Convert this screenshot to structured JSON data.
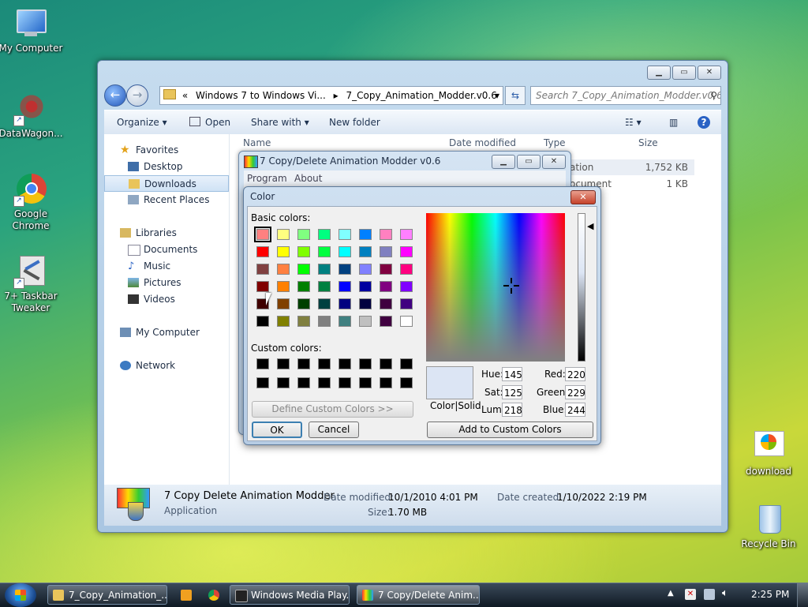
{
  "desktop": {
    "icons": [
      {
        "label": "My Computer"
      },
      {
        "label": "DataWagon..."
      },
      {
        "label": "Google Chrome"
      },
      {
        "label": "7+ Taskbar Tweaker"
      },
      {
        "label": "download"
      },
      {
        "label": "Recycle Bin"
      }
    ]
  },
  "explorer": {
    "address_crumbs": [
      "Windows 7 to Windows Vi...",
      "7_Copy_Animation_Modder.v0.6"
    ],
    "search_placeholder": "Search 7_Copy_Animation_Modder.v0.6",
    "toolbar": {
      "organize": "Organize",
      "open": "Open",
      "share_with": "Share with",
      "new_folder": "New folder"
    },
    "nav": {
      "favorites": "Favorites",
      "desktop": "Desktop",
      "downloads": "Downloads",
      "recent": "Recent Places",
      "libraries": "Libraries",
      "documents": "Documents",
      "music": "Music",
      "pictures": "Pictures",
      "videos": "Videos",
      "my_computer": "My Computer",
      "network": "Network"
    },
    "columns": {
      "name": "Name",
      "date": "Date modified",
      "type": "Type",
      "size": "Size"
    },
    "rows": [
      {
        "type": "ation",
        "size": "1,752 KB"
      },
      {
        "type": "ocument",
        "size": "1 KB"
      }
    ],
    "details": {
      "name": "7 Copy Delete Animation Modder",
      "kind": "Application",
      "date_modified_label": "Date modified:",
      "date_modified": "10/1/2010 4:01 PM",
      "size_label": "Size:",
      "size": "1.70 MB",
      "date_created_label": "Date created:",
      "date_created": "1/10/2022 2:19 PM"
    }
  },
  "modder": {
    "title": "7 Copy/Delete Animation Modder v0.6",
    "menu": {
      "program": "Program",
      "about": "About"
    }
  },
  "color_dialog": {
    "title": "Color",
    "basic_label": "Basic colors:",
    "custom_label": "Custom colors:",
    "define_button": "Define Custom Colors >>",
    "ok": "OK",
    "cancel": "Cancel",
    "add_button": "Add to Custom Colors",
    "color_solid": "Color|Solid",
    "fields": {
      "hue_label": "Hue:",
      "hue": "145",
      "sat_label": "Sat:",
      "sat": "125",
      "lum_label": "Lum:",
      "lum": "218",
      "red_label": "Red:",
      "red": "220",
      "green_label": "Green:",
      "green": "229",
      "blue_label": "Blue:",
      "blue": "244"
    },
    "preview_color": "#DCE5F4",
    "basic_colors": [
      [
        "#FF8080",
        "#FFFF80",
        "#80FF80",
        "#00FF80",
        "#80FFFF",
        "#0080FF",
        "#FF80C0",
        "#FF80FF"
      ],
      [
        "#FF0000",
        "#FFFF00",
        "#80FF00",
        "#00FF40",
        "#00FFFF",
        "#0080C0",
        "#8080C0",
        "#FF00FF"
      ],
      [
        "#804040",
        "#FF8040",
        "#00FF00",
        "#008080",
        "#004080",
        "#8080FF",
        "#800040",
        "#FF0080"
      ],
      [
        "#800000",
        "#FF8000",
        "#008000",
        "#008040",
        "#0000FF",
        "#0000A0",
        "#800080",
        "#8000FF"
      ],
      [
        "#400000",
        "#804000",
        "#004000",
        "#004040",
        "#000080",
        "#000040",
        "#400040",
        "#400080"
      ],
      [
        "#000000",
        "#808000",
        "#808040",
        "#808080",
        "#408080",
        "#C0C0C0",
        "#400040",
        "#FFFFFF"
      ]
    ]
  },
  "taskbar": {
    "tasks": [
      "7_Copy_Animation_...",
      "Windows Media Play...",
      "7 Copy/Delete Anim..."
    ],
    "clock": "2:25 PM"
  }
}
